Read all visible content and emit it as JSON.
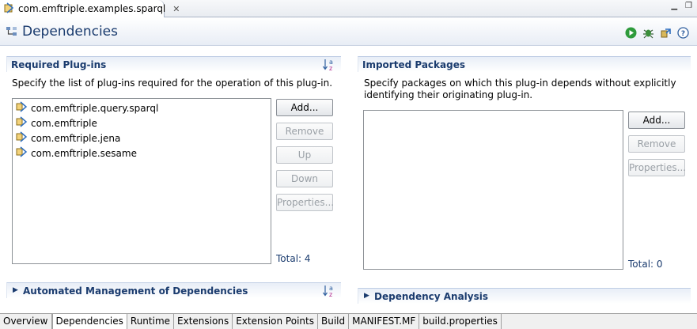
{
  "editor_tab": {
    "label": "com.emftriple.examples.sparql",
    "close": "✕"
  },
  "window_controls": {
    "minimize": "▁",
    "maximize": "❐"
  },
  "form": {
    "title": "Dependencies"
  },
  "required": {
    "title": "Required Plug-ins",
    "description": "Specify the list of plug-ins required for the operation of this plug-in.",
    "items": [
      {
        "label": "com.emftriple.query.sparql"
      },
      {
        "label": "com.emftriple"
      },
      {
        "label": "com.emftriple.jena"
      },
      {
        "label": "com.emftriple.sesame"
      }
    ],
    "buttons": {
      "add": "Add...",
      "remove": "Remove",
      "up": "Up",
      "down": "Down",
      "properties": "Properties..."
    },
    "total": "Total: 4"
  },
  "imported": {
    "title": "Imported Packages",
    "description_line1": "Specify packages on which this plug-in depends without explicitly",
    "description_line2": "identifying their originating plug-in.",
    "buttons": {
      "add": "Add...",
      "remove": "Remove",
      "properties": "Properties..."
    },
    "total": "Total: 0"
  },
  "collapsed_sections": {
    "automated": "Automated Management of Dependencies",
    "analysis": "Dependency Analysis"
  },
  "page_tabs": [
    {
      "label": "Overview"
    },
    {
      "label": "Dependencies"
    },
    {
      "label": "Runtime"
    },
    {
      "label": "Extensions"
    },
    {
      "label": "Extension Points"
    },
    {
      "label": "Build"
    },
    {
      "label": "MANIFEST.MF"
    },
    {
      "label": "build.properties"
    }
  ],
  "active_page_tab": "Dependencies",
  "colors": {
    "section_title": "#1a3b6e",
    "header_title": "#1a3b6e"
  },
  "icons": {
    "editor_tab": "plugin-manifest-icon",
    "form_title": "dependencies-icon",
    "header_tools": [
      "run-icon",
      "debug-icon",
      "export-icon",
      "help-icon"
    ],
    "plugin": "plugin-icon",
    "sort": "sort-alpha-icon"
  }
}
